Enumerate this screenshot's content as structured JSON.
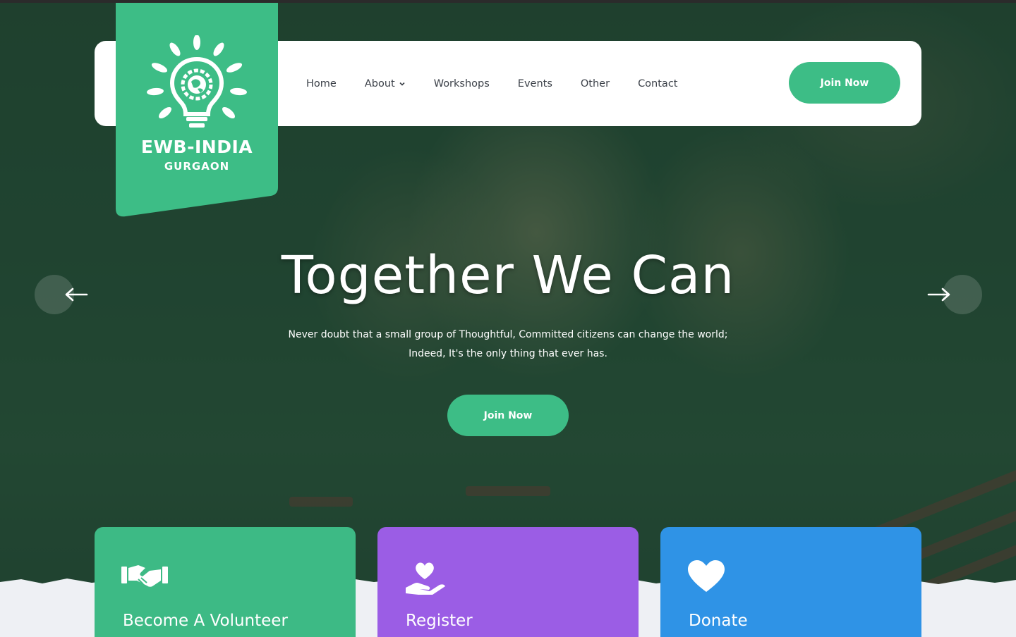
{
  "brand": {
    "name": "EWB-INDIA",
    "location": "GURGAON"
  },
  "nav": {
    "items": [
      {
        "label": "Home",
        "has_dropdown": false
      },
      {
        "label": "About",
        "has_dropdown": true
      },
      {
        "label": "Workshops",
        "has_dropdown": false
      },
      {
        "label": "Events",
        "has_dropdown": false
      },
      {
        "label": "Other",
        "has_dropdown": false
      },
      {
        "label": "Contact",
        "has_dropdown": false
      }
    ],
    "cta_label": "Join Now"
  },
  "hero": {
    "title": "Together We Can",
    "subtitle_line1": "Never doubt that a small group of Thoughtful, Committed citizens can change the world;",
    "subtitle_line2": "Indeed, It's the only thing that ever has.",
    "cta_label": "Join Now",
    "prev_icon": "arrow-left-icon",
    "next_icon": "arrow-right-icon"
  },
  "cards": [
    {
      "title": "Become A Volunteer",
      "icon": "handshake-icon",
      "color": "#3dba85"
    },
    {
      "title": "Register",
      "icon": "heart-hand-icon",
      "color": "#9b5de5"
    },
    {
      "title": "Donate",
      "icon": "heart-icon",
      "color": "#2f93e6"
    }
  ],
  "colors": {
    "accent": "#3dbd86",
    "nav_text": "#3b4048",
    "bottom_bg": "#eef0f4"
  }
}
